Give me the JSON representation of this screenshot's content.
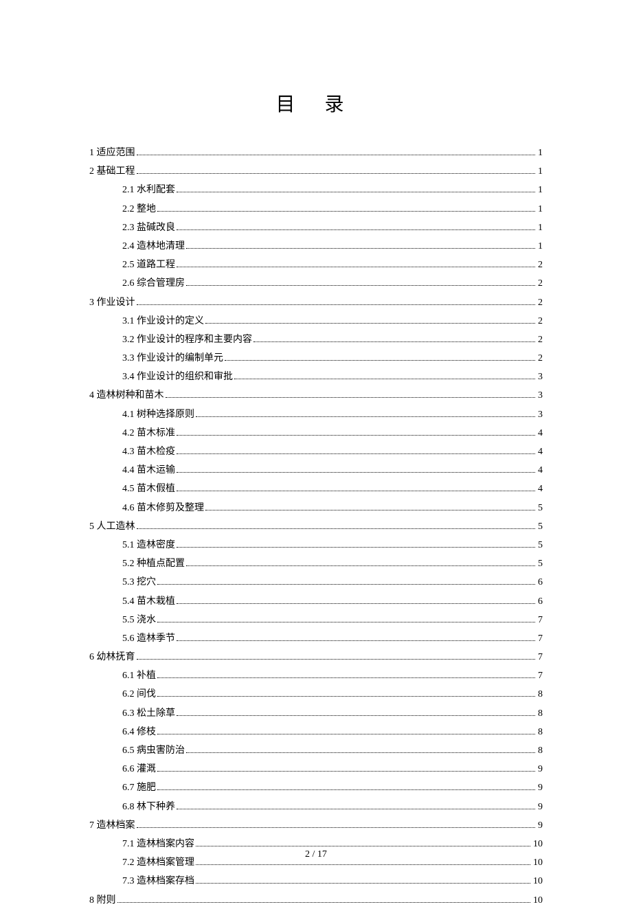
{
  "title": "目 录",
  "footer": "2 / 17",
  "toc": [
    {
      "level": 1,
      "label": "1 适应范围",
      "page": "1"
    },
    {
      "level": 1,
      "label": "2 基础工程",
      "page": "1"
    },
    {
      "level": 2,
      "label": "2.1 水利配套",
      "page": "1"
    },
    {
      "level": 2,
      "label": "2.2 整地",
      "page": "1"
    },
    {
      "level": 2,
      "label": "2.3 盐碱改良",
      "page": "1"
    },
    {
      "level": 2,
      "label": "2.4 造林地清理",
      "page": "1"
    },
    {
      "level": 2,
      "label": "2.5 道路工程",
      "page": "2"
    },
    {
      "level": 2,
      "label": "2.6 综合管理房",
      "page": "2"
    },
    {
      "level": 1,
      "label": "3 作业设计",
      "page": "2"
    },
    {
      "level": 2,
      "label": "3.1 作业设计的定义",
      "page": "2"
    },
    {
      "level": 2,
      "label": "3.2 作业设计的程序和主要内容",
      "page": "2"
    },
    {
      "level": 2,
      "label": "3.3 作业设计的编制单元",
      "page": "2"
    },
    {
      "level": 2,
      "label": "3.4 作业设计的组织和审批",
      "page": "3"
    },
    {
      "level": 1,
      "label": "4 造林树种和苗木",
      "page": "3"
    },
    {
      "level": 2,
      "label": "4.1 树种选择原则",
      "page": "3"
    },
    {
      "level": 2,
      "label": "4.2 苗木标准",
      "page": "4"
    },
    {
      "level": 2,
      "label": "4.3 苗木检疫",
      "page": "4"
    },
    {
      "level": 2,
      "label": "4.4 苗木运输",
      "page": "4"
    },
    {
      "level": 2,
      "label": "4.5 苗木假植",
      "page": "4"
    },
    {
      "level": 2,
      "label": "4.6 苗木修剪及整理",
      "page": "5"
    },
    {
      "level": 1,
      "label": "5 人工造林",
      "page": "5"
    },
    {
      "level": 2,
      "label": "5.1 造林密度",
      "page": "5"
    },
    {
      "level": 2,
      "label": "5.2 种植点配置",
      "page": "5"
    },
    {
      "level": 2,
      "label": "5.3 挖穴",
      "page": "6"
    },
    {
      "level": 2,
      "label": "5.4 苗木栽植",
      "page": "6"
    },
    {
      "level": 2,
      "label": "5.5 浇水",
      "page": "7"
    },
    {
      "level": 2,
      "label": "5.6 造林季节",
      "page": "7"
    },
    {
      "level": 1,
      "label": "6 幼林抚育",
      "page": "7"
    },
    {
      "level": 2,
      "label": "6.1 补植",
      "page": "7"
    },
    {
      "level": 2,
      "label": "6.2 间伐",
      "page": "8"
    },
    {
      "level": 2,
      "label": "6.3 松土除草",
      "page": "8"
    },
    {
      "level": 2,
      "label": "6.4 修枝",
      "page": "8"
    },
    {
      "level": 2,
      "label": "6.5 病虫害防治",
      "page": "8"
    },
    {
      "level": 2,
      "label": "6.6 灌溉",
      "page": "9"
    },
    {
      "level": 2,
      "label": "6.7 施肥",
      "page": "9"
    },
    {
      "level": 2,
      "label": "6.8 林下种养",
      "page": "9"
    },
    {
      "level": 1,
      "label": "7 造林档案",
      "page": "9"
    },
    {
      "level": 2,
      "label": "7.1 造林档案内容",
      "page": "10"
    },
    {
      "level": 2,
      "label": "7.2 造林档案管理",
      "page": "10"
    },
    {
      "level": 2,
      "label": "7.3 造林档案存档",
      "page": "10"
    },
    {
      "level": 1,
      "label": "8 附则",
      "page": "10"
    }
  ]
}
